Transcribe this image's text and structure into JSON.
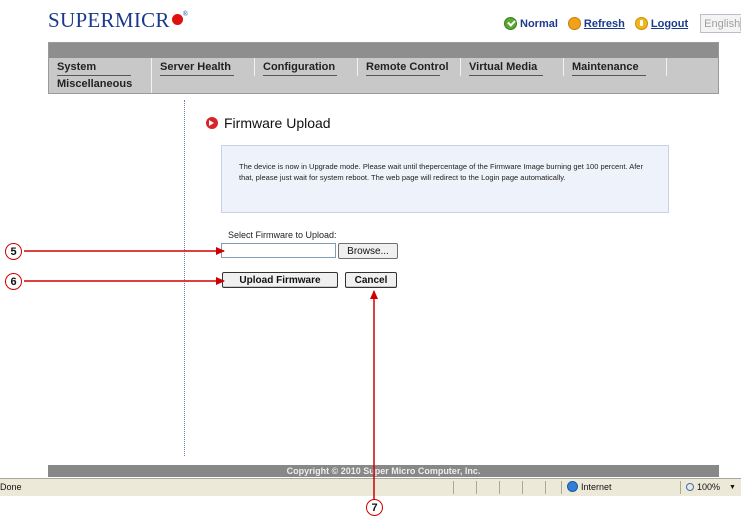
{
  "header": {
    "logo_text": "SUPERMICR",
    "logo_reg": "®",
    "status_label": "Normal",
    "refresh_label": "Refresh",
    "logout_label": "Logout",
    "language_selected": "English"
  },
  "nav": {
    "tabs": [
      {
        "label": "System"
      },
      {
        "label": "Server Health"
      },
      {
        "label": "Configuration"
      },
      {
        "label": "Remote Control"
      },
      {
        "label": "Virtual Media"
      },
      {
        "label": "Maintenance"
      }
    ],
    "row2": [
      {
        "label": "Miscellaneous"
      }
    ]
  },
  "main": {
    "title": "Firmware Upload",
    "notice": "The device is now in Upgrade mode. Please wait until thepercentage of the Firmware Image burning get 100 percent. Afer that, please just wait for system reboot. The web page will redirect to the Login page automatically.",
    "select_label": "Select Firmware to Upload:",
    "file_value": "",
    "browse_label": "Browse...",
    "upload_label": "Upload Firmware",
    "cancel_label": "Cancel"
  },
  "footer": {
    "copyright": "Copyright © 2010 Super Micro Computer, Inc."
  },
  "statusbar": {
    "status": "Done",
    "zone": "Internet",
    "zoom": "100%"
  },
  "annotations": {
    "callout_5": "5",
    "callout_6": "6",
    "callout_7": "7",
    "color": "#d00000"
  }
}
